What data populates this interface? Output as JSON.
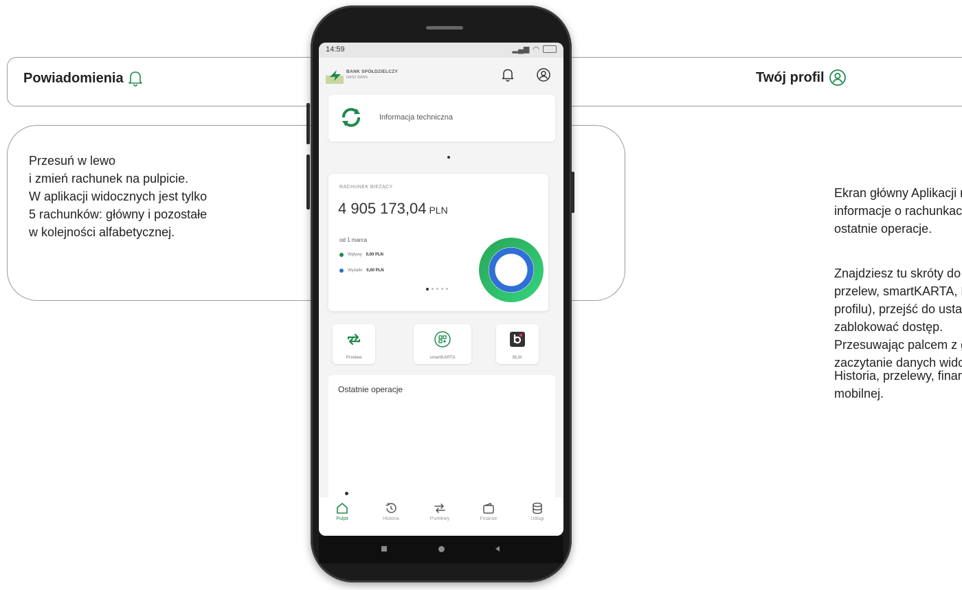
{
  "callouts": {
    "notifications": {
      "title": "Powiadomienia",
      "icon": "bell-icon"
    },
    "profile": {
      "title": "Twój profil",
      "icon": "profile-icon"
    },
    "swipe": {
      "lines": [
        "Przesuń w lewo",
        "i zmień rachunek na pulpicie.",
        "W aplikacji widocznych jest tylko",
        "5 rachunków: główny i pozostałe",
        "w kolejności alfabetycznej."
      ]
    }
  },
  "info": {
    "p1": [
      "Ekran główny Aplikacji mo",
      "informacje o rachunkach: s",
      "ostatnie operacje."
    ],
    "p2": [
      "Znajdziesz tu skróty do naj",
      "przelew, smartKARTA, BLIK",
      "profilu), przejść do ustaw",
      "zablokować dostęp.",
      "Przesuwając palcem z gór",
      "zaczytanie danych widoczn"
    ],
    "p3": [
      "Historia, przelewy, finanse",
      "mobilnej."
    ]
  },
  "phone": {
    "status_time": "14:59",
    "bank_name": "BANK SPÓŁDZIELCZY",
    "bank_sub": "NASZ BANK",
    "tech_info_label": "Informacja techniczna",
    "account": {
      "type": "RACHUNEK BIEŻĄCY",
      "amount": "4 905 173,04",
      "currency": "PLN",
      "since": "od 1 marca",
      "legend": [
        {
          "label": "Wpływy",
          "value": "0,00 PLN",
          "color": "#1f8a4c"
        },
        {
          "label": "Wydatki",
          "value": "0,00 PLN",
          "color": "#2f6fd6"
        }
      ]
    },
    "shortcuts": [
      "Przelew",
      "smartKARTA",
      "BLIK"
    ],
    "recent_title": "Ostatnie operacje",
    "nav": [
      "Pulpit",
      "Historia",
      "Przelewy",
      "Finanse",
      "Usługi"
    ]
  },
  "colors": {
    "accent": "#1f8a4c",
    "blue": "#2f6fd6",
    "frame": "#9a9a9a"
  }
}
